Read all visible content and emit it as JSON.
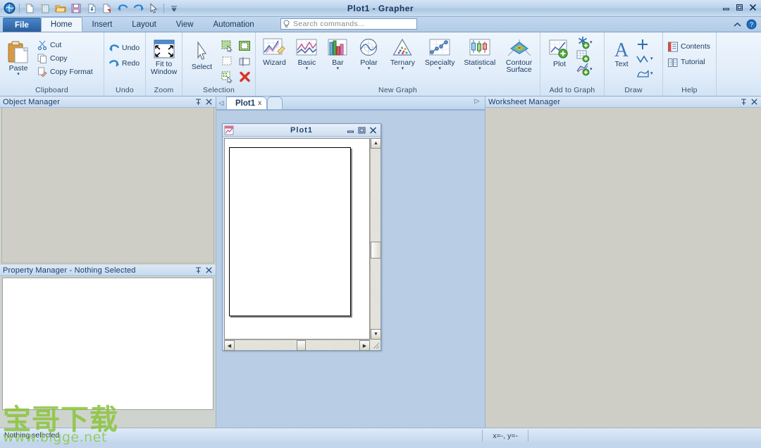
{
  "window": {
    "title": "Plot1 - Grapher",
    "controls": {
      "minimize": "minimize-icon",
      "maximize": "maximize-icon",
      "close": "close-icon"
    }
  },
  "quick_access": [
    {
      "name": "app-menu-icon",
      "label": "Grapher"
    },
    {
      "name": "new-plot-icon",
      "label": "New Plot"
    },
    {
      "name": "new-worksheet-icon",
      "label": "New Worksheet"
    },
    {
      "name": "open-icon",
      "label": "Open"
    },
    {
      "name": "save-icon",
      "label": "Save"
    },
    {
      "name": "import-icon",
      "label": "Import"
    },
    {
      "name": "export-icon",
      "label": "Export"
    },
    {
      "name": "undo-icon",
      "label": "Undo"
    },
    {
      "name": "redo-icon",
      "label": "Redo"
    },
    {
      "name": "select-arrow-icon",
      "label": "Select"
    },
    {
      "name": "customize-qat-icon",
      "label": "Customize Quick Access Toolbar"
    }
  ],
  "ribbon_tabs": [
    {
      "label": "File",
      "active": false,
      "style": "file"
    },
    {
      "label": "Home",
      "active": true
    },
    {
      "label": "Insert",
      "active": false
    },
    {
      "label": "Layout",
      "active": false
    },
    {
      "label": "View",
      "active": false
    },
    {
      "label": "Automation",
      "active": false
    }
  ],
  "search": {
    "placeholder": "Search commands...",
    "value": "",
    "icon": "lightbulb-icon"
  },
  "ribbon_right": {
    "collapse": "collapse-ribbon-icon",
    "help": "help-icon"
  },
  "ribbon_groups": [
    {
      "name": "Clipboard",
      "big": [
        {
          "label": "Paste",
          "icon": "paste-icon",
          "has_caret": true
        }
      ],
      "small": [
        {
          "label": "Cut",
          "icon": "cut-icon"
        },
        {
          "label": "Copy",
          "icon": "copy-icon"
        },
        {
          "label": "Copy Format",
          "icon": "copy-format-icon"
        }
      ]
    },
    {
      "name": "Undo",
      "big": [],
      "small": [
        {
          "label": "Undo",
          "icon": "undo-arrow-icon"
        },
        {
          "label": "Redo",
          "icon": "redo-arrow-icon"
        }
      ]
    },
    {
      "name": "Zoom",
      "big": [
        {
          "label": "Fit to Window",
          "icon": "fit-to-window-icon",
          "has_caret": false
        }
      ],
      "small": []
    },
    {
      "name": "Selection",
      "big": [
        {
          "label": "Select",
          "icon": "select-arrow-icon",
          "has_caret": false
        }
      ],
      "grid": [
        {
          "label": "Select All",
          "icon": "select-all-icon"
        },
        {
          "label": "Select Object",
          "icon": "select-object-icon"
        },
        {
          "label": "Deselect",
          "icon": "deselect-icon"
        },
        {
          "label": "Invert Selection",
          "icon": "invert-selection-icon"
        },
        {
          "label": "Select Similar",
          "icon": "select-similar-icon"
        },
        {
          "label": "Delete",
          "icon": "delete-red-x-icon"
        }
      ]
    },
    {
      "name": "New Graph",
      "big": [
        {
          "label": "Wizard",
          "icon": "graph-wizard-icon",
          "has_caret": false
        },
        {
          "label": "Basic",
          "icon": "basic-graph-icon",
          "has_caret": true
        },
        {
          "label": "Bar",
          "icon": "bar-chart-icon",
          "has_caret": true
        },
        {
          "label": "Polar",
          "icon": "polar-plot-icon",
          "has_caret": true
        },
        {
          "label": "Ternary",
          "icon": "ternary-plot-icon",
          "has_caret": true
        },
        {
          "label": "Specialty",
          "icon": "specialty-plot-icon",
          "has_caret": true
        },
        {
          "label": "Statistical",
          "icon": "statistical-plot-icon",
          "has_caret": true
        },
        {
          "label": "Contour Surface",
          "icon": "contour-surface-icon",
          "has_caret": true
        }
      ],
      "small": []
    },
    {
      "name": "Add to Graph",
      "big": [
        {
          "label": "Plot",
          "icon": "add-plot-icon",
          "has_caret": false
        }
      ],
      "grid": [
        {
          "label": "Add Function",
          "icon": "add-function-icon"
        },
        {
          "label": "Add Table",
          "icon": "add-table-icon"
        },
        {
          "label": "Add Fit Curve",
          "icon": "add-fit-curve-icon"
        }
      ]
    },
    {
      "name": "Draw",
      "big": [
        {
          "label": "Text",
          "icon": "text-tool-icon",
          "has_caret": false
        }
      ],
      "grid": [
        {
          "label": "Line",
          "icon": "draw-line-icon"
        },
        {
          "label": "Polyline",
          "icon": "draw-polyline-icon"
        },
        {
          "label": "Polygon",
          "icon": "draw-polygon-icon"
        }
      ]
    },
    {
      "name": "Help",
      "big": [],
      "small": [
        {
          "label": "Contents",
          "icon": "contents-book-icon"
        },
        {
          "label": "Tutorial",
          "icon": "tutorial-book-icon"
        }
      ]
    }
  ],
  "panels": {
    "object_manager": {
      "title": "Object Manager",
      "pin": "pin-icon",
      "close": "close-icon"
    },
    "property_manager": {
      "title": "Property Manager - Nothing Selected",
      "pin": "pin-icon",
      "close": "close-icon"
    },
    "worksheet_manager": {
      "title": "Worksheet Manager",
      "pin": "pin-icon",
      "close": "close-icon"
    }
  },
  "document_tabs": {
    "prev": "nav-prev-icon",
    "next": "nav-next-icon",
    "tabs": [
      {
        "label": "Plot1",
        "close": "x",
        "active": true
      }
    ]
  },
  "mdi_window": {
    "title": "Plot1",
    "icon": "plot-document-icon",
    "minimize": "minimize-icon",
    "restore": "restore-icon",
    "close": "close-icon"
  },
  "status_bar": {
    "message": "Nothing selected",
    "coordinates": "x=-, y=-"
  },
  "watermark": {
    "text_cn": "宝哥下载",
    "url": "www.bigge.net",
    "color": "#8cc63f"
  },
  "colors": {
    "titlebar": "#bed5ec",
    "ribbon_bg": "#e3eefa",
    "file_tab": "#2a5f9e",
    "panel_bg": "#cfcec6",
    "mdi_bg": "#b9cde4",
    "accent": "#17365d"
  }
}
